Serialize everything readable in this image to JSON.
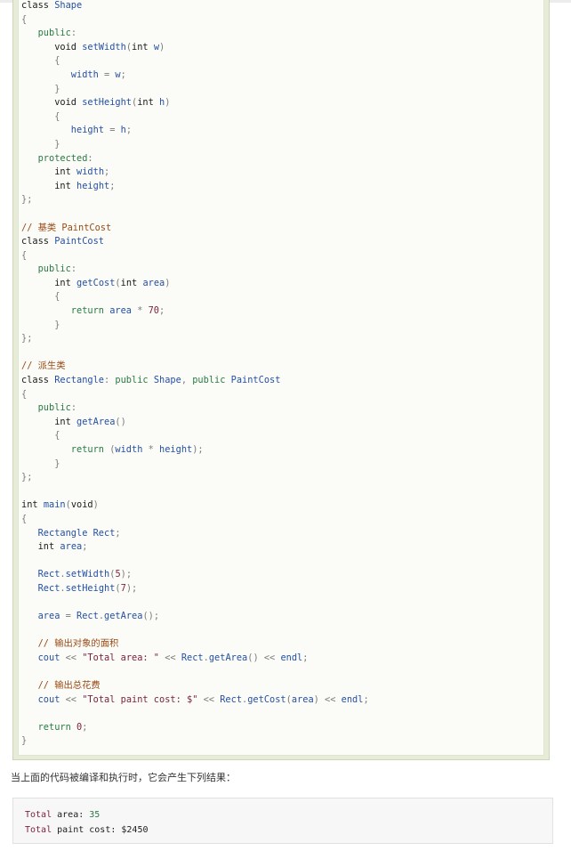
{
  "code_lines": [
    [
      [
        "kw",
        "class "
      ],
      [
        "id",
        "Shape"
      ]
    ],
    [
      [
        "pn",
        "{"
      ]
    ],
    [
      [
        "pl",
        "   "
      ],
      [
        "ac",
        "public"
      ],
      [
        "pn",
        ":"
      ]
    ],
    [
      [
        "pl",
        "      "
      ],
      [
        "kw",
        "void "
      ],
      [
        "fn",
        "setWidth"
      ],
      [
        "pn",
        "("
      ],
      [
        "kw",
        "int "
      ],
      [
        "id",
        "w"
      ],
      [
        "pn",
        ")"
      ]
    ],
    [
      [
        "pl",
        "      "
      ],
      [
        "pn",
        "{"
      ]
    ],
    [
      [
        "pl",
        "         "
      ],
      [
        "id",
        "width "
      ],
      [
        "pn",
        "= "
      ],
      [
        "id",
        "w"
      ],
      [
        "pn",
        ";"
      ]
    ],
    [
      [
        "pl",
        "      "
      ],
      [
        "pn",
        "}"
      ]
    ],
    [
      [
        "pl",
        "      "
      ],
      [
        "kw",
        "void "
      ],
      [
        "fn",
        "setHeight"
      ],
      [
        "pn",
        "("
      ],
      [
        "kw",
        "int "
      ],
      [
        "id",
        "h"
      ],
      [
        "pn",
        ")"
      ]
    ],
    [
      [
        "pl",
        "      "
      ],
      [
        "pn",
        "{"
      ]
    ],
    [
      [
        "pl",
        "         "
      ],
      [
        "id",
        "height "
      ],
      [
        "pn",
        "= "
      ],
      [
        "id",
        "h"
      ],
      [
        "pn",
        ";"
      ]
    ],
    [
      [
        "pl",
        "      "
      ],
      [
        "pn",
        "}"
      ]
    ],
    [
      [
        "pl",
        "   "
      ],
      [
        "ac",
        "protected"
      ],
      [
        "pn",
        ":"
      ]
    ],
    [
      [
        "pl",
        "      "
      ],
      [
        "kw",
        "int "
      ],
      [
        "id",
        "width"
      ],
      [
        "pn",
        ";"
      ]
    ],
    [
      [
        "pl",
        "      "
      ],
      [
        "kw",
        "int "
      ],
      [
        "id",
        "height"
      ],
      [
        "pn",
        ";"
      ]
    ],
    [
      [
        "pn",
        "};"
      ]
    ],
    [],
    [
      [
        "cm",
        "// 基类 PaintCost"
      ]
    ],
    [
      [
        "kw",
        "class "
      ],
      [
        "id",
        "PaintCost"
      ]
    ],
    [
      [
        "pn",
        "{"
      ]
    ],
    [
      [
        "pl",
        "   "
      ],
      [
        "ac",
        "public"
      ],
      [
        "pn",
        ":"
      ]
    ],
    [
      [
        "pl",
        "      "
      ],
      [
        "kw",
        "int "
      ],
      [
        "fn",
        "getCost"
      ],
      [
        "pn",
        "("
      ],
      [
        "kw",
        "int "
      ],
      [
        "id",
        "area"
      ],
      [
        "pn",
        ")"
      ]
    ],
    [
      [
        "pl",
        "      "
      ],
      [
        "pn",
        "{"
      ]
    ],
    [
      [
        "pl",
        "         "
      ],
      [
        "ac",
        "return "
      ],
      [
        "id",
        "area "
      ],
      [
        "pn",
        "* "
      ],
      [
        "nm",
        "70"
      ],
      [
        "pn",
        ";"
      ]
    ],
    [
      [
        "pl",
        "      "
      ],
      [
        "pn",
        "}"
      ]
    ],
    [
      [
        "pn",
        "};"
      ]
    ],
    [],
    [
      [
        "cm",
        "// 派生类"
      ]
    ],
    [
      [
        "kw",
        "class "
      ],
      [
        "id",
        "Rectangle"
      ],
      [
        "pn",
        ": "
      ],
      [
        "ac",
        "public "
      ],
      [
        "id",
        "Shape"
      ],
      [
        "pn",
        ", "
      ],
      [
        "ac",
        "public "
      ],
      [
        "id",
        "PaintCost"
      ]
    ],
    [
      [
        "pn",
        "{"
      ]
    ],
    [
      [
        "pl",
        "   "
      ],
      [
        "ac",
        "public"
      ],
      [
        "pn",
        ":"
      ]
    ],
    [
      [
        "pl",
        "      "
      ],
      [
        "kw",
        "int "
      ],
      [
        "fn",
        "getArea"
      ],
      [
        "pn",
        "()"
      ]
    ],
    [
      [
        "pl",
        "      "
      ],
      [
        "pn",
        "{"
      ]
    ],
    [
      [
        "pl",
        "         "
      ],
      [
        "ac",
        "return "
      ],
      [
        "pn",
        "("
      ],
      [
        "id",
        "width "
      ],
      [
        "pn",
        "* "
      ],
      [
        "id",
        "height"
      ],
      [
        "pn",
        ");"
      ]
    ],
    [
      [
        "pl",
        "      "
      ],
      [
        "pn",
        "}"
      ]
    ],
    [
      [
        "pn",
        "};"
      ]
    ],
    [],
    [
      [
        "kw",
        "int "
      ],
      [
        "fn",
        "main"
      ],
      [
        "pn",
        "("
      ],
      [
        "kw",
        "void"
      ],
      [
        "pn",
        ")"
      ]
    ],
    [
      [
        "pn",
        "{"
      ]
    ],
    [
      [
        "pl",
        "   "
      ],
      [
        "id",
        "Rectangle "
      ],
      [
        "id",
        "Rect"
      ],
      [
        "pn",
        ";"
      ]
    ],
    [
      [
        "pl",
        "   "
      ],
      [
        "kw",
        "int "
      ],
      [
        "id",
        "area"
      ],
      [
        "pn",
        ";"
      ]
    ],
    [],
    [
      [
        "pl",
        "   "
      ],
      [
        "id",
        "Rect"
      ],
      [
        "pn",
        "."
      ],
      [
        "fn",
        "setWidth"
      ],
      [
        "pn",
        "("
      ],
      [
        "nm",
        "5"
      ],
      [
        "pn",
        ");"
      ]
    ],
    [
      [
        "pl",
        "   "
      ],
      [
        "id",
        "Rect"
      ],
      [
        "pn",
        "."
      ],
      [
        "fn",
        "setHeight"
      ],
      [
        "pn",
        "("
      ],
      [
        "nm",
        "7"
      ],
      [
        "pn",
        ");"
      ]
    ],
    [],
    [
      [
        "pl",
        "   "
      ],
      [
        "id",
        "area "
      ],
      [
        "pn",
        "= "
      ],
      [
        "id",
        "Rect"
      ],
      [
        "pn",
        "."
      ],
      [
        "fn",
        "getArea"
      ],
      [
        "pn",
        "();"
      ]
    ],
    [],
    [
      [
        "pl",
        "   "
      ],
      [
        "cm",
        "// 输出对象的面积"
      ]
    ],
    [
      [
        "pl",
        "   "
      ],
      [
        "id",
        "cout "
      ],
      [
        "pn",
        "<< "
      ],
      [
        "st",
        "\"Total area: \" "
      ],
      [
        "pn",
        "<< "
      ],
      [
        "id",
        "Rect"
      ],
      [
        "pn",
        "."
      ],
      [
        "fn",
        "getArea"
      ],
      [
        "pn",
        "() << "
      ],
      [
        "id",
        "endl"
      ],
      [
        "pn",
        ";"
      ]
    ],
    [],
    [
      [
        "pl",
        "   "
      ],
      [
        "cm",
        "// 输出总花费"
      ]
    ],
    [
      [
        "pl",
        "   "
      ],
      [
        "id",
        "cout "
      ],
      [
        "pn",
        "<< "
      ],
      [
        "st",
        "\"Total paint cost: $\" "
      ],
      [
        "pn",
        "<< "
      ],
      [
        "id",
        "Rect"
      ],
      [
        "pn",
        "."
      ],
      [
        "fn",
        "getCost"
      ],
      [
        "pn",
        "("
      ],
      [
        "id",
        "area"
      ],
      [
        "pn",
        ") << "
      ],
      [
        "id",
        "endl"
      ],
      [
        "pn",
        ";"
      ]
    ],
    [],
    [
      [
        "pl",
        "   "
      ],
      [
        "ac",
        "return "
      ],
      [
        "nm",
        "0"
      ],
      [
        "pn",
        ";"
      ]
    ],
    [
      [
        "pn",
        "}"
      ]
    ]
  ],
  "description": "当上面的代码被编译和执行时，它会产生下列结果：",
  "output": [
    {
      "label": "Total",
      "text": " area: ",
      "value": "35"
    },
    {
      "label": "Total",
      "text": " paint cost: $2450",
      "value": ""
    }
  ]
}
